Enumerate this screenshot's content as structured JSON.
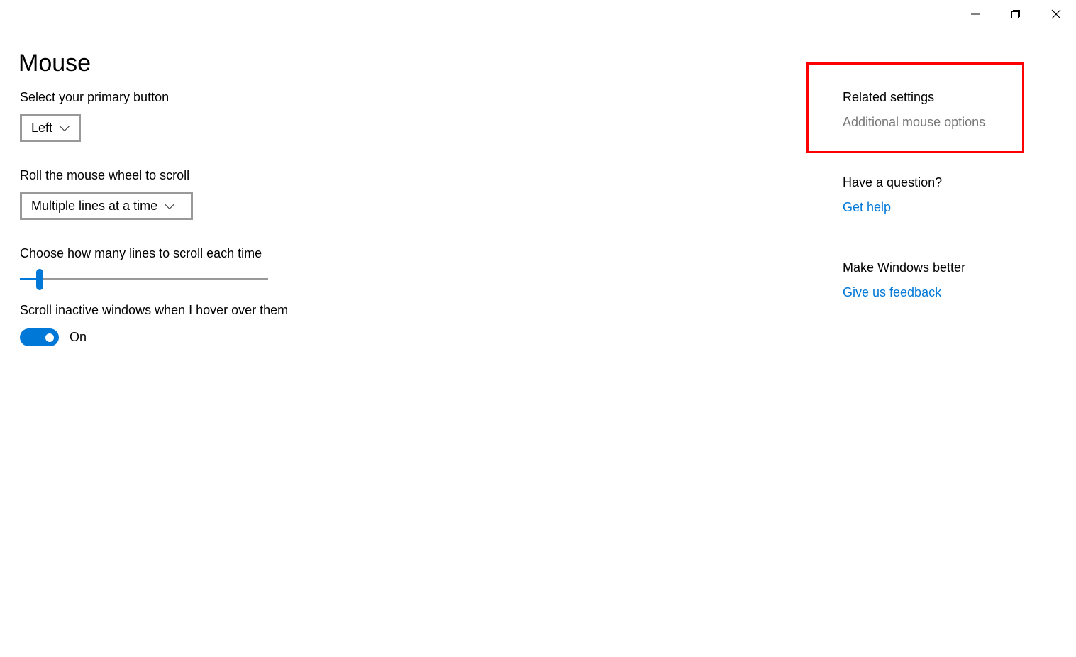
{
  "window": {
    "minimize_icon": "minimize-icon",
    "restore_icon": "restore-icon",
    "close_icon": "close-icon"
  },
  "page": {
    "title": "Mouse"
  },
  "primary_button": {
    "label": "Select your primary button",
    "value": "Left"
  },
  "wheel_scroll": {
    "label": "Roll the mouse wheel to scroll",
    "value": "Multiple lines at a time"
  },
  "lines_slider": {
    "label": "Choose how many lines to scroll each time",
    "level_fraction": 0.08
  },
  "inactive_scroll": {
    "label": "Scroll inactive windows when I hover over them",
    "state": "On",
    "on": true
  },
  "related": {
    "heading": "Related settings",
    "link": "Additional mouse options",
    "highlight_color": "#ff0000"
  },
  "question": {
    "heading": "Have a question?",
    "link": "Get help"
  },
  "feedback": {
    "heading": "Make Windows better",
    "link": "Give us feedback"
  },
  "colors": {
    "accent": "#0078d7"
  }
}
